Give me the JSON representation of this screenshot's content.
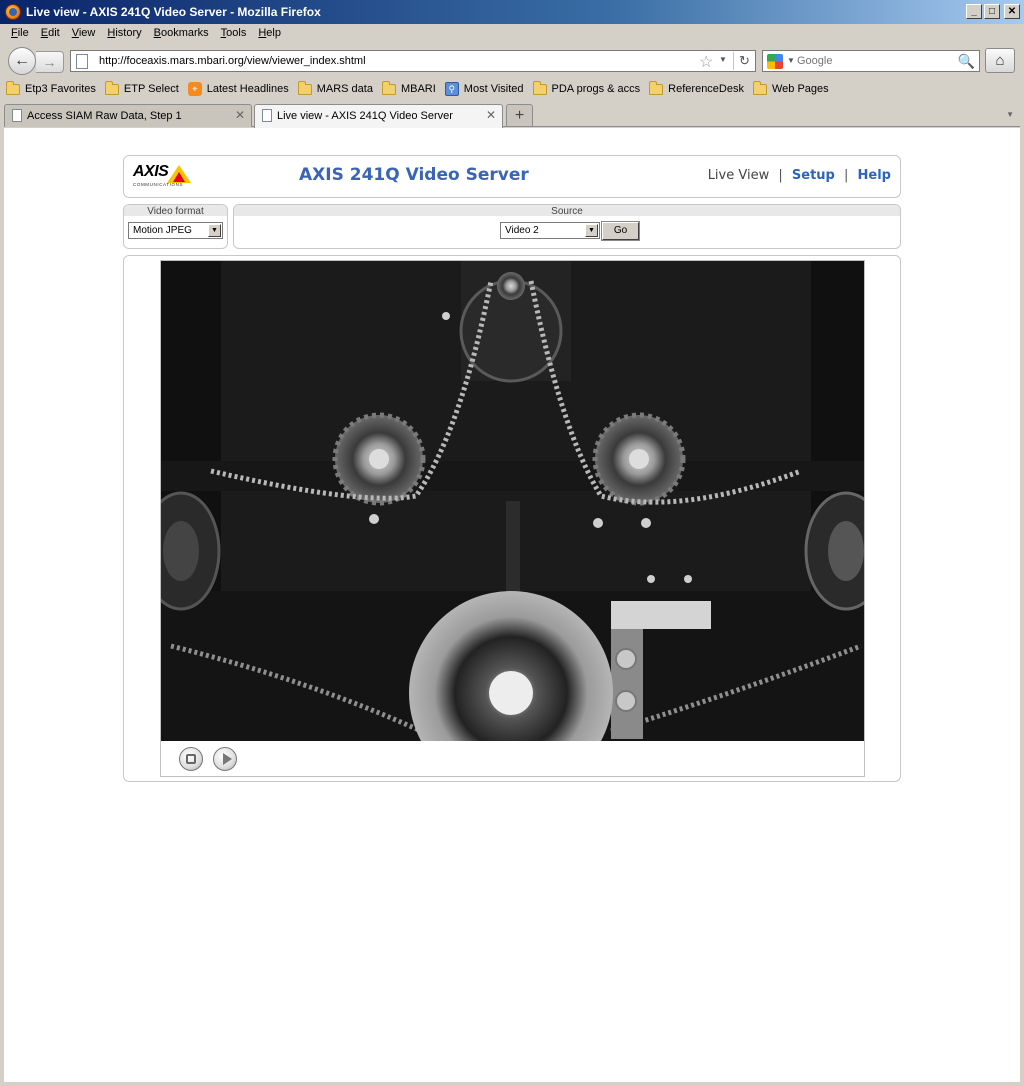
{
  "window": {
    "title": "Live view - AXIS 241Q Video Server - Mozilla Firefox",
    "buttons": {
      "minimize": "_",
      "maximize": "□",
      "close": "✕"
    }
  },
  "menubar": [
    {
      "key": "F",
      "rest": "ile"
    },
    {
      "key": "E",
      "rest": "dit"
    },
    {
      "key": "V",
      "rest": "iew"
    },
    {
      "key": "H",
      "rest": "istory"
    },
    {
      "key": "B",
      "rest": "ookmarks"
    },
    {
      "key": "T",
      "rest": "ools"
    },
    {
      "key": "H",
      "rest": "elp"
    }
  ],
  "navigation": {
    "url": "http://foceaxis.mars.mbari.org/view/viewer_index.shtml",
    "search_placeholder": "Google"
  },
  "bookmarks": [
    {
      "label": "Etp3 Favorites",
      "icon": "folder-icon"
    },
    {
      "label": "ETP Select",
      "icon": "folder-icon"
    },
    {
      "label": "Latest Headlines",
      "icon": "rss-icon"
    },
    {
      "label": "MARS data",
      "icon": "folder-icon"
    },
    {
      "label": "MBARI",
      "icon": "folder-icon"
    },
    {
      "label": "Most Visited",
      "icon": "smart-folder-icon"
    },
    {
      "label": "PDA progs & accs",
      "icon": "folder-icon"
    },
    {
      "label": "ReferenceDesk",
      "icon": "folder-icon"
    },
    {
      "label": "Web Pages",
      "icon": "folder-icon"
    }
  ],
  "tabs": [
    {
      "label": "Access SIAM Raw Data, Step 1",
      "active": false
    },
    {
      "label": "Live view - AXIS 241Q Video Server",
      "active": true
    }
  ],
  "page": {
    "logo_text": "AXIS",
    "logo_subtext": "COMMUNICATIONS",
    "product_title": "AXIS 241Q Video Server",
    "links": {
      "live_view": "Live View",
      "separator": "|",
      "setup": "Setup",
      "help": "Help"
    },
    "video_format": {
      "legend": "Video format",
      "selected": "Motion JPEG"
    },
    "source": {
      "legend": "Source",
      "selected": "Video 2",
      "go_label": "Go"
    },
    "player": {
      "stop": "stop",
      "play": "play"
    }
  },
  "colors": {
    "accent_blue": "#2f63c0",
    "title_blue": "#3a64b5",
    "axis_yellow": "#f6c400",
    "axis_red": "#e2001a"
  }
}
